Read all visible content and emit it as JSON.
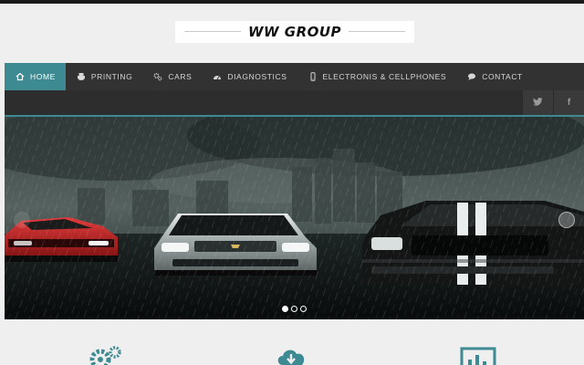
{
  "header": {
    "logo_text": "WW GROUP"
  },
  "nav": {
    "items": [
      {
        "label": "HOME",
        "icon": "home-icon",
        "active": true
      },
      {
        "label": "PRINTING",
        "icon": "printer-icon",
        "active": false
      },
      {
        "label": "CARS",
        "icon": "gears-icon",
        "active": false
      },
      {
        "label": "DIAGNOSTICS",
        "icon": "dashboard-icon",
        "active": false
      },
      {
        "label": "ELECTRONIS & CELLPHONES",
        "icon": "cellphone-icon",
        "active": false
      },
      {
        "label": "CONTACT",
        "icon": "chat-icon",
        "active": false
      }
    ]
  },
  "social": {
    "twitter": "twitter-icon",
    "facebook_glyph": "f"
  },
  "slider": {
    "slide_count": 3,
    "active_slide": 1
  },
  "features": [
    {
      "icon": "gears-icon"
    },
    {
      "icon": "cloud-download-icon"
    },
    {
      "icon": "bar-chart-icon"
    }
  ],
  "colors": {
    "accent": "#3d8a93",
    "nav_bg": "#323232",
    "page_bg": "#efefef"
  }
}
